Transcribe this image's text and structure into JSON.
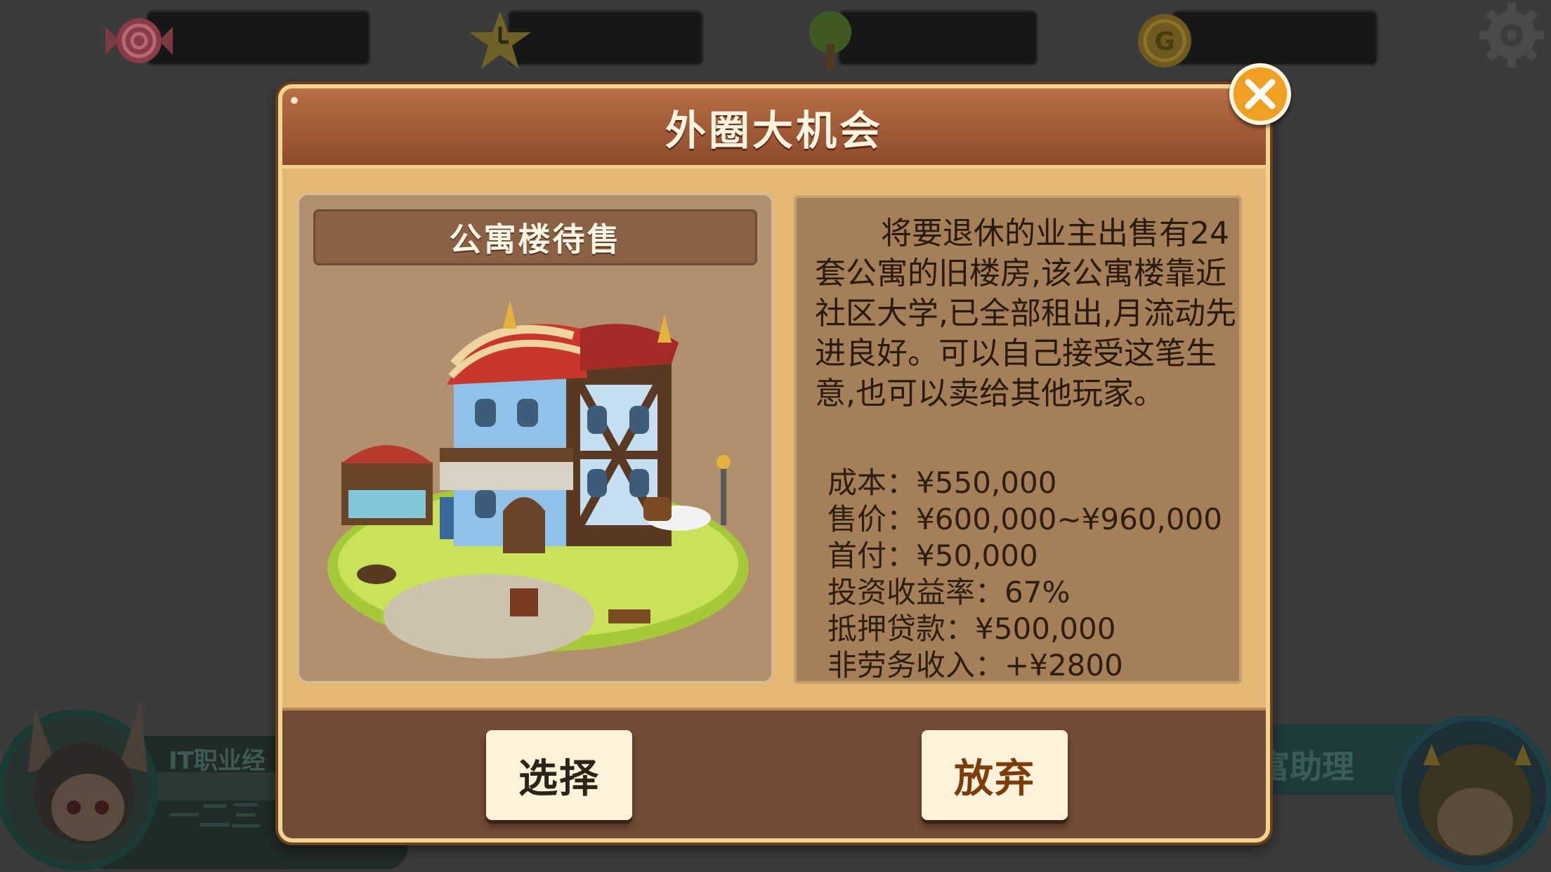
{
  "dialog": {
    "title": "外圈大机会",
    "close_icon": "close-icon"
  },
  "property": {
    "name": "公寓楼待售",
    "image_icon": "apartment-building-illustration",
    "description": "将要退休的业主出售有24套公寓的旧楼房,该公寓楼靠近社区大学,已全部租出,月流动先进良好。可以自己接受这笔生意,也可以卖给其他玩家。",
    "stats": [
      {
        "label": "成本",
        "value": "¥550,000"
      },
      {
        "label": "售价",
        "value": "¥600,000~¥960,000"
      },
      {
        "label": "首付",
        "value": "¥50,000"
      },
      {
        "label": "投资收益率",
        "value": "67%"
      },
      {
        "label": "抵押贷款",
        "value": "¥500,000"
      },
      {
        "label": "非劳务收入",
        "value": "+¥2800"
      }
    ]
  },
  "actions": {
    "select_label": "选择",
    "abandon_label": "放弃"
  },
  "background": {
    "player_title": "IT职业经",
    "player_name": "一二三",
    "assistant_label": "富助理",
    "hud_icons": [
      "candy-icon",
      "star-clock-icon",
      "tree-icon",
      "gold-coin-icon",
      "gear-icon"
    ]
  },
  "colors": {
    "dialog_bg": "#e3b872",
    "title_bar": "#8d4a2b",
    "close_button": "#f0a020",
    "button_bg": "#fff2db",
    "abandon_text": "#7c3d09"
  }
}
